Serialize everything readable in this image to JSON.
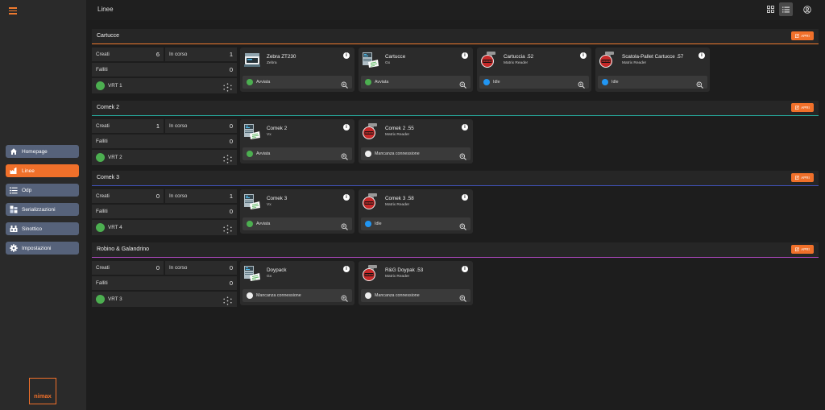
{
  "header": {
    "title": "Linee"
  },
  "sidebar": {
    "items": [
      {
        "label": "Homepage",
        "icon": "home-icon"
      },
      {
        "label": "Linee",
        "icon": "factory-icon",
        "active": true
      },
      {
        "label": "Odp",
        "icon": "list-icon"
      },
      {
        "label": "Serializzazioni",
        "icon": "serialization-icon"
      },
      {
        "label": "Sinottico",
        "icon": "synoptic-icon"
      },
      {
        "label": "Impostazioni",
        "icon": "gear-icon"
      }
    ],
    "logo_text": "nimax"
  },
  "apri_label": "APRI",
  "colors": {
    "accent": "#f0702a",
    "line_cartucce": "#f07a2e",
    "line_comek2": "#26a69a",
    "line_comek3": "#3f51b5",
    "line_robino": "#ab47bc",
    "status_green": "#4caf50",
    "status_blue": "#2196f3",
    "status_white": "#eeeeee"
  },
  "lines": [
    {
      "name": "Cartucce",
      "creati_label": "Creati",
      "creati": "6",
      "in_corso_label": "In corso",
      "in_corso": "1",
      "falliti_label": "Falliti",
      "falliti": "0",
      "vrt": "VRT 1",
      "devices": [
        {
          "name": "Zebra ZT230",
          "sub": "Zebra",
          "status": "Avviata",
          "status_color": "green",
          "kind": "printer"
        },
        {
          "name": "Cartucce",
          "sub": "Gx",
          "status": "Avviata",
          "status_color": "green",
          "kind": "printer2"
        },
        {
          "name": "Cartuccia .52",
          "sub": "Matrix Reader",
          "status": "Idle",
          "status_color": "blue",
          "kind": "reader"
        },
        {
          "name": "Scatola-Pallet Cartucce .57",
          "sub": "Matrix Reader",
          "status": "Idle",
          "status_color": "blue",
          "kind": "reader"
        }
      ]
    },
    {
      "name": "Comek 2",
      "creati_label": "Creati",
      "creati": "1",
      "in_corso_label": "In corso",
      "in_corso": "0",
      "falliti_label": "Falliti",
      "falliti": "0",
      "vrt": "VRT 2",
      "devices": [
        {
          "name": "Comek 2",
          "sub": "Vx",
          "status": "Avviata",
          "status_color": "green",
          "kind": "printer2"
        },
        {
          "name": "Comek 2 .55",
          "sub": "Matrix Reader",
          "status": "Mancanza connessione",
          "status_color": "white",
          "kind": "reader"
        }
      ]
    },
    {
      "name": "Comek 3",
      "creati_label": "Creati",
      "creati": "0",
      "in_corso_label": "In corso",
      "in_corso": "1",
      "falliti_label": "Falliti",
      "falliti": "0",
      "vrt": "VRT 4",
      "devices": [
        {
          "name": "Comek 3",
          "sub": "Vx",
          "status": "Avviata",
          "status_color": "green",
          "kind": "printer2"
        },
        {
          "name": "Comek 3 .58",
          "sub": "Matrix Reader",
          "status": "Idle",
          "status_color": "blue",
          "kind": "reader"
        }
      ]
    },
    {
      "name": "Robino & Galandrino",
      "creati_label": "Creati",
      "creati": "0",
      "in_corso_label": "In corso",
      "in_corso": "0",
      "falliti_label": "Falliti",
      "falliti": "0",
      "vrt": "VRT 3",
      "devices": [
        {
          "name": "Doypack",
          "sub": "Gx",
          "status": "Mancanza connessione",
          "status_color": "white",
          "kind": "printer2"
        },
        {
          "name": "R&G Doypak .53",
          "sub": "Matrix Reader",
          "status": "Mancanza connessione",
          "status_color": "white",
          "kind": "reader"
        }
      ]
    }
  ]
}
